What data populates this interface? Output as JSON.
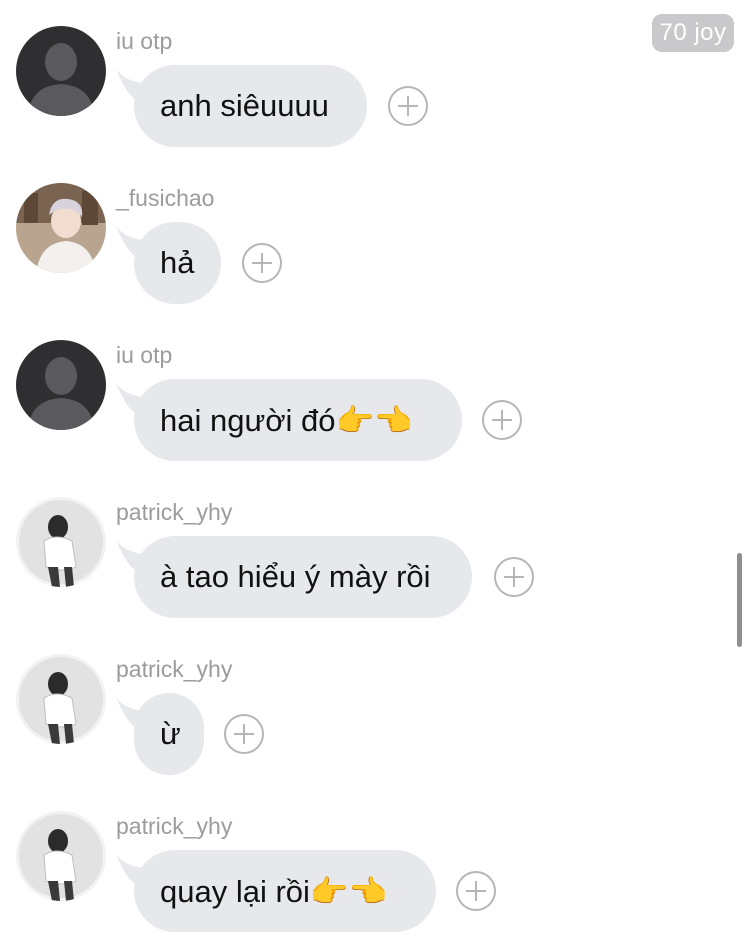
{
  "header": {
    "badge_text": "70 joy"
  },
  "messages": [
    {
      "username": "iu otp",
      "text": "anh siêuuuu",
      "avatar": "default-silhouette"
    },
    {
      "username": "_fusichao",
      "text": "hả",
      "avatar": "photo-fusichao"
    },
    {
      "username": "iu otp",
      "text": "hai người đó👉👈",
      "avatar": "default-silhouette"
    },
    {
      "username": "patrick_yhy",
      "text": "à tao hiểu ý mày rồi",
      "avatar": "photo-patrick"
    },
    {
      "username": "patrick_yhy",
      "text": "ừ",
      "avatar": "photo-patrick"
    },
    {
      "username": "patrick_yhy",
      "text": "quay lại rồi👉👈",
      "avatar": "photo-patrick"
    }
  ],
  "icons": {
    "add_reaction": "plus-circle-icon"
  },
  "colors": {
    "bubble": "#e6e8eb",
    "username": "#9b9ba0",
    "badge_bg": "#c9c9cc"
  }
}
